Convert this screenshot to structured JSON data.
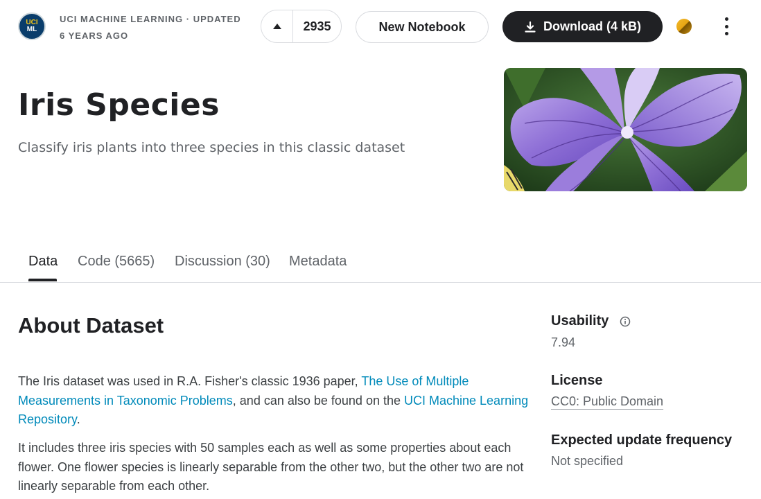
{
  "header": {
    "org_logo_line1": "UCI",
    "org_logo_line2": "ML",
    "owner_line1": "UCI MACHINE LEARNING · UPDATED",
    "owner_line2": "6 YEARS AGO",
    "vote_count": "2935",
    "new_notebook_label": "New Notebook",
    "download_label": "Download (4 kB)"
  },
  "dataset": {
    "title": "Iris Species",
    "subtitle": "Classify iris plants into three species in this classic dataset"
  },
  "tabs": [
    {
      "label": "Data"
    },
    {
      "label": "Code (5665)"
    },
    {
      "label": "Discussion (30)"
    },
    {
      "label": "Metadata"
    }
  ],
  "about": {
    "heading": "About Dataset",
    "p1_text1": "The Iris dataset was used in R.A. Fisher's classic 1936 paper, ",
    "p1_link1": "The Use of Multiple Measurements in Taxonomic Problems",
    "p1_text2": ", and can also be found on the ",
    "p1_link2": "UCI Machine Learning Repository",
    "p1_text3": ".",
    "p2": "It includes three iris species with 50 samples each as well as some properties about each flower. One flower species is linearly separable from the other two, but the other two are not linearly separable from each other."
  },
  "sidebar": {
    "usability_label": "Usability",
    "usability_value": "7.94",
    "license_label": "License",
    "license_value": "CC0: Public Domain",
    "update_label": "Expected update frequency",
    "update_value": "Not specified"
  },
  "colors": {
    "link": "#008aba",
    "primary_button": "#202124",
    "logo_bg": "#0a3d6b",
    "logo_accent": "#f5c518"
  }
}
